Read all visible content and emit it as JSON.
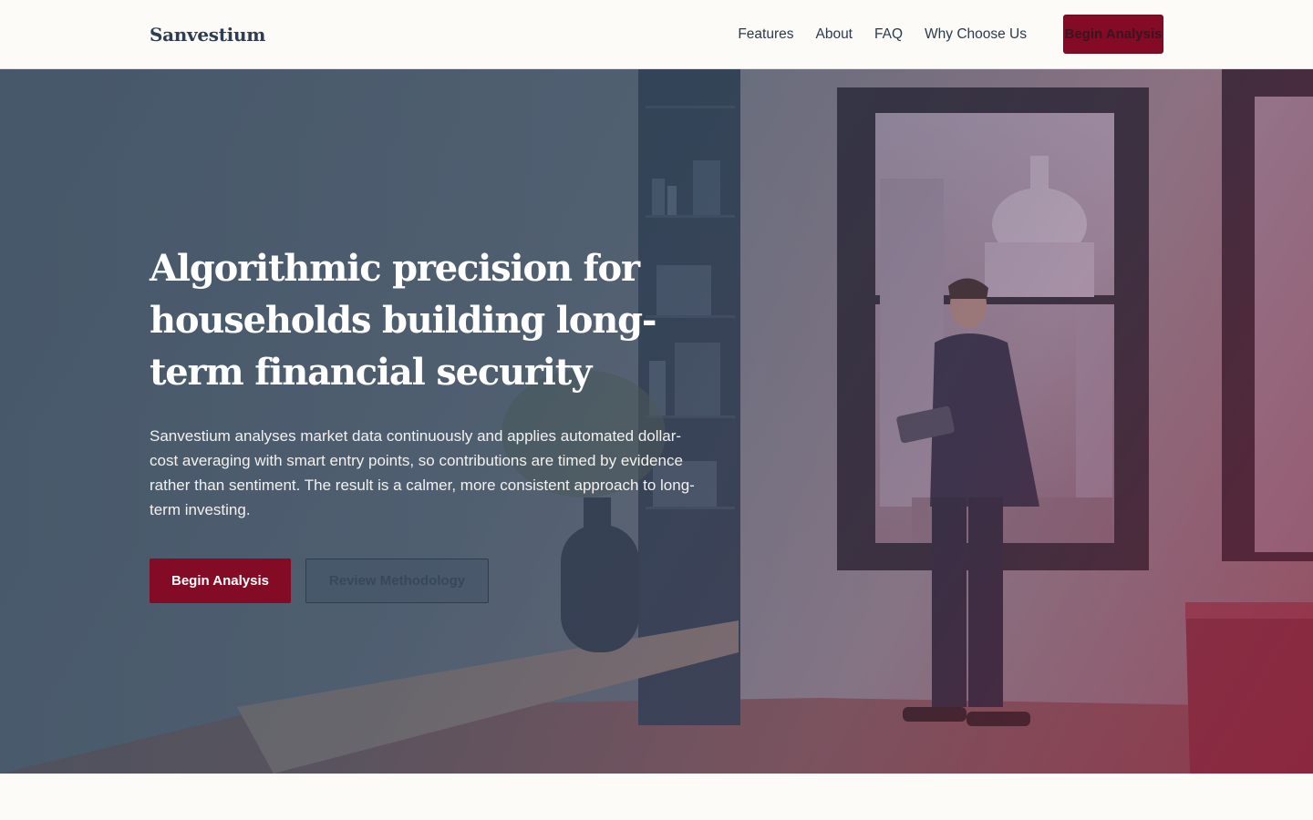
{
  "brand": {
    "name": "Sanvestium"
  },
  "nav": {
    "items": [
      {
        "label": "Features"
      },
      {
        "label": "About"
      },
      {
        "label": "FAQ"
      },
      {
        "label": "Why Choose Us"
      }
    ],
    "cta_label": "Begin Analysis"
  },
  "hero": {
    "title": "Algorithmic precision for households building long-term financial security",
    "description": "Sanvestium analyses market data continuously and applies automated dollar-cost averaging with smart entry points, so contributions are timed by evidence rather than sentiment. The result is a calmer, more consistent approach to long-term investing.",
    "primary_cta": "Begin Analysis",
    "secondary_cta": "Review Methodology"
  },
  "colors": {
    "accent": "#830b25",
    "ink": "#2e3e50",
    "background": "#fcfbf7"
  }
}
